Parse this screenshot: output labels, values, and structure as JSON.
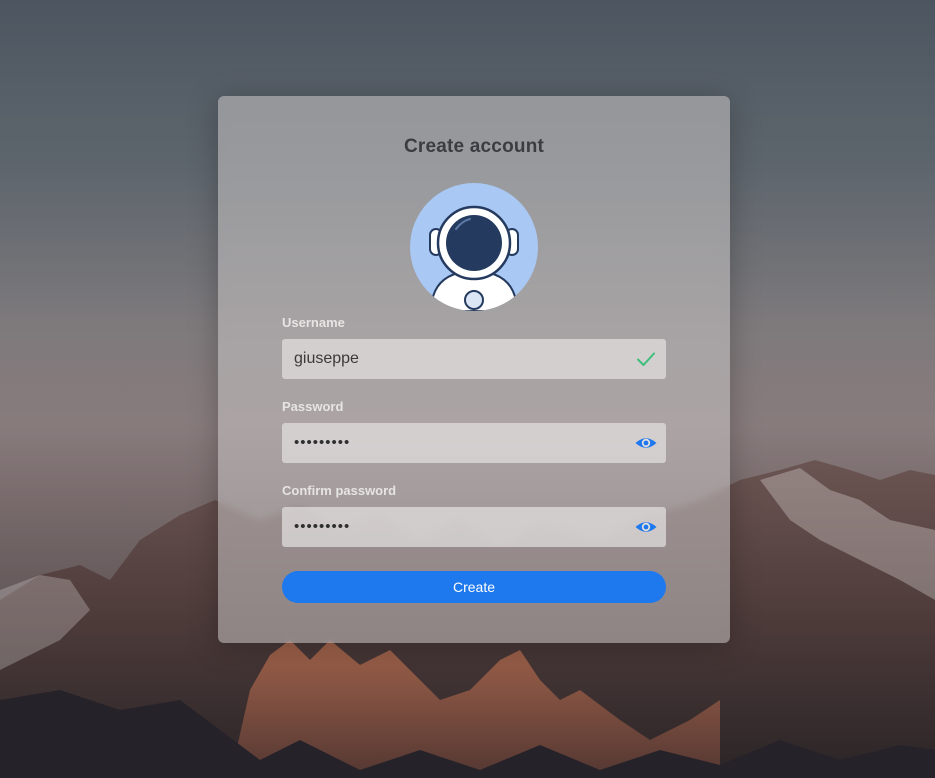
{
  "page": {
    "title": "Create account"
  },
  "colors": {
    "accent": "#1e78ee",
    "valid": "#3cbf7a",
    "avatar_bg": "#a9c8f3",
    "helmet_visor": "#243a5e"
  },
  "avatar": {
    "icon": "astronaut-icon"
  },
  "form": {
    "username": {
      "label": "Username",
      "value": "giuseppe",
      "status_icon": "checkmark-icon"
    },
    "password": {
      "label": "Password",
      "value_masked": "•••••••••",
      "toggle_icon": "eye-icon"
    },
    "confirm_password": {
      "label": "Confirm password",
      "value_masked": "•••••••••",
      "toggle_icon": "eye-icon"
    },
    "submit_label": "Create"
  }
}
